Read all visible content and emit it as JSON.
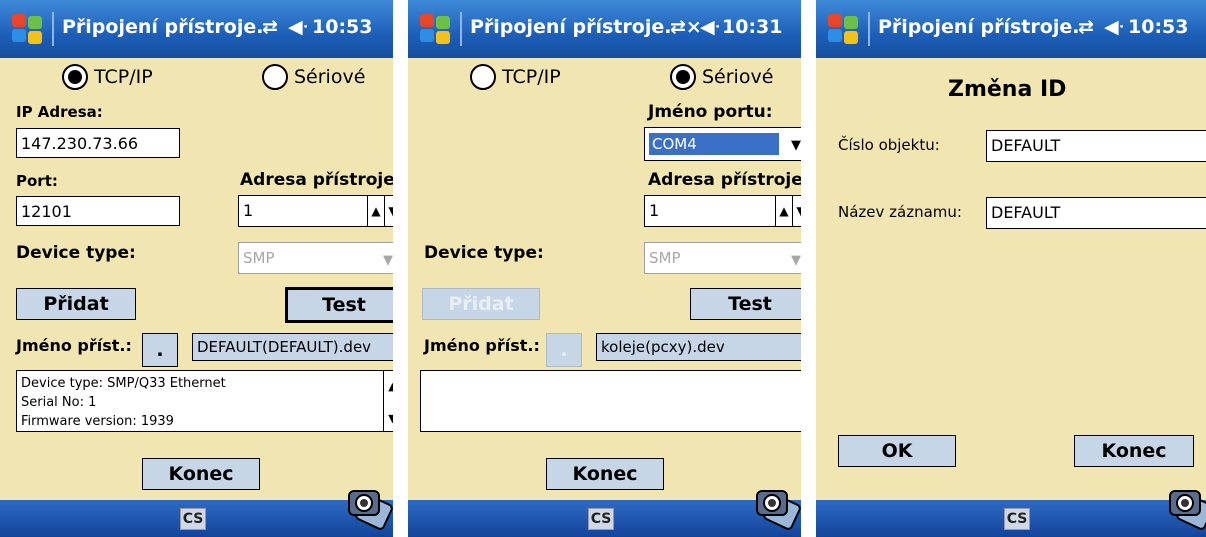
{
  "screens": [
    {
      "title": "Připojení přístroje.",
      "status_icon": "⇄",
      "volume_icon": "◀ᐧ",
      "time": "10:53",
      "radio_tcp": "TCP/IP",
      "radio_serial": "Sériové",
      "ip_label": "IP Adresa:",
      "ip_value": "147.230.73.66",
      "port_label": "Port:",
      "port_value": "12101",
      "device_addr_label": "Adresa přístroje:",
      "device_addr_value": "1",
      "device_type_label": "Device type:",
      "device_type_value": "SMP",
      "add_button": "Přidat",
      "test_button": "Test",
      "device_name_label": "Jméno příst.:",
      "dot_button": ".",
      "device_file": "DEFAULT(DEFAULT).dev",
      "info_lines": [
        "Device type: SMP/Q33  Ethernet",
        "Serial No: 1",
        "Firmware version: 1939"
      ],
      "end_button": "Konec",
      "lang": "CS"
    },
    {
      "title": "Připojení přístroje.",
      "status_icon": "⇄×",
      "volume_icon": "◀ᐧ",
      "time": "10:31",
      "radio_tcp": "TCP/IP",
      "radio_serial": "Sériové",
      "port_name_label": "Jméno portu:",
      "port_name_value": "COM4",
      "device_addr_label": "Adresa přístroje:",
      "device_addr_value": "1",
      "device_type_label": "Device type:",
      "device_type_value": "SMP",
      "add_button": "Přidat",
      "test_button": "Test",
      "device_name_label": "Jméno příst.:",
      "dot_button": ".",
      "device_file": "koleje(pcxy).dev",
      "end_button": "Konec",
      "lang": "CS"
    },
    {
      "title": "Připojení přístroje.",
      "status_icon": "⇄",
      "volume_icon": "◀ᐧ",
      "time": "10:53",
      "heading": "Změna ID",
      "object_label": "Číslo objektu:",
      "object_value": "DEFAULT",
      "record_label": "Název záznamu:",
      "record_value": "DEFAULT",
      "ok_button": "OK",
      "end_button": "Konec",
      "lang": "CS"
    }
  ],
  "colors": {
    "titlebar": "#1d5fb8",
    "background": "#f1e6b2",
    "button": "#c6d6e6",
    "selection": "#3a6fc6"
  }
}
